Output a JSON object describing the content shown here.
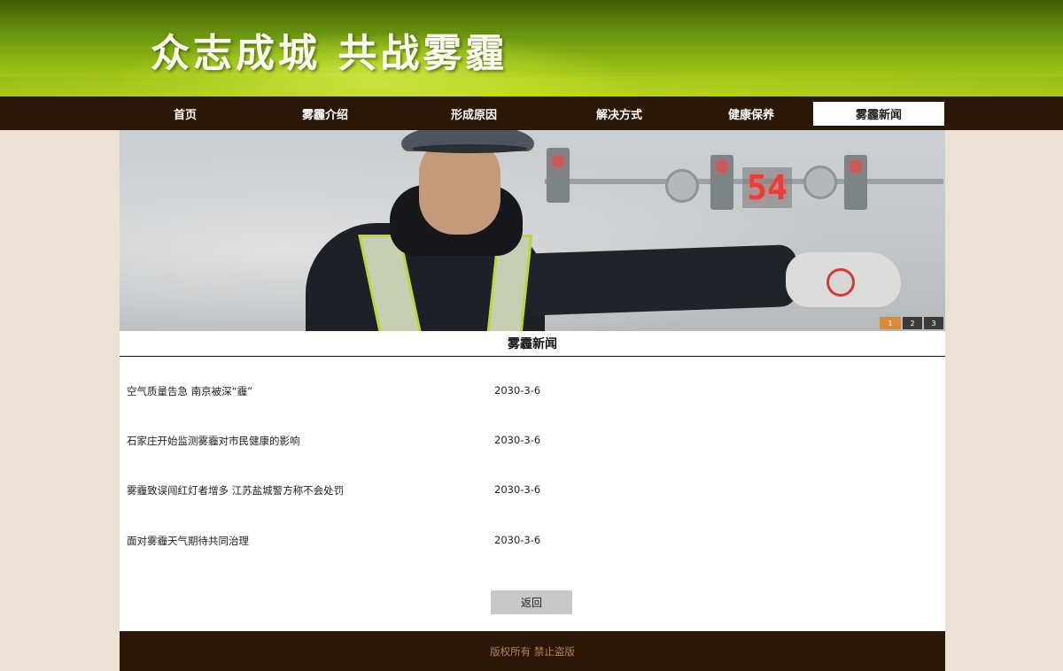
{
  "banner": {
    "title": "众志成城 共战雾霾"
  },
  "nav": {
    "items": [
      {
        "label": "首页",
        "active": false
      },
      {
        "label": "雾霾介绍",
        "active": false
      },
      {
        "label": "形成原因",
        "active": false
      },
      {
        "label": "解决方式",
        "active": false
      },
      {
        "label": "健康保养",
        "active": false
      },
      {
        "label": "雾霾新闻",
        "active": true
      }
    ]
  },
  "hero": {
    "countdown_text": "54",
    "slides": [
      "1",
      "2",
      "3"
    ],
    "active_slide": "1",
    "accent_color": "#d98b3c"
  },
  "news": {
    "section_title": "雾霾新闻",
    "items": [
      {
        "title": "空气质量告急 南京被深“霾”",
        "date": "2030-3-6"
      },
      {
        "title": "石家庄开始监测雾霾对市民健康的影响",
        "date": "2030-3-6"
      },
      {
        "title": "雾霾致误闯红灯者增多 江苏盐城警方称不会处罚",
        "date": "2030-3-6"
      },
      {
        "title": "面对雾霾天气期待共同治理",
        "date": "2030-3-6"
      }
    ],
    "back_label": "返回"
  },
  "footer": {
    "text": "版权所有 禁止盗版"
  },
  "colors": {
    "nav_bg": "#2a1708",
    "page_bg": "#ebe2d3",
    "banner_green": "#6f9a10",
    "footer_text": "#b78353"
  }
}
